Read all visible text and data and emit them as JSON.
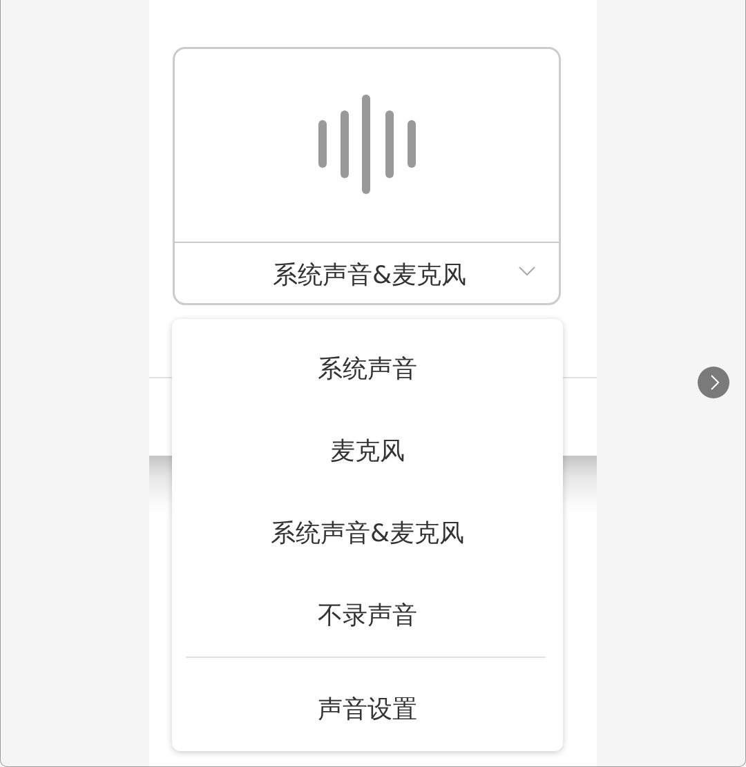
{
  "audio_source": {
    "label": "系统声音&麦克风",
    "expanded": true
  },
  "menu": {
    "options": [
      {
        "label": "系统声音"
      },
      {
        "label": "麦克风"
      },
      {
        "label": "系统声音&麦克风"
      },
      {
        "label": "不录声音"
      }
    ],
    "settings": {
      "label": "声音设置"
    }
  }
}
